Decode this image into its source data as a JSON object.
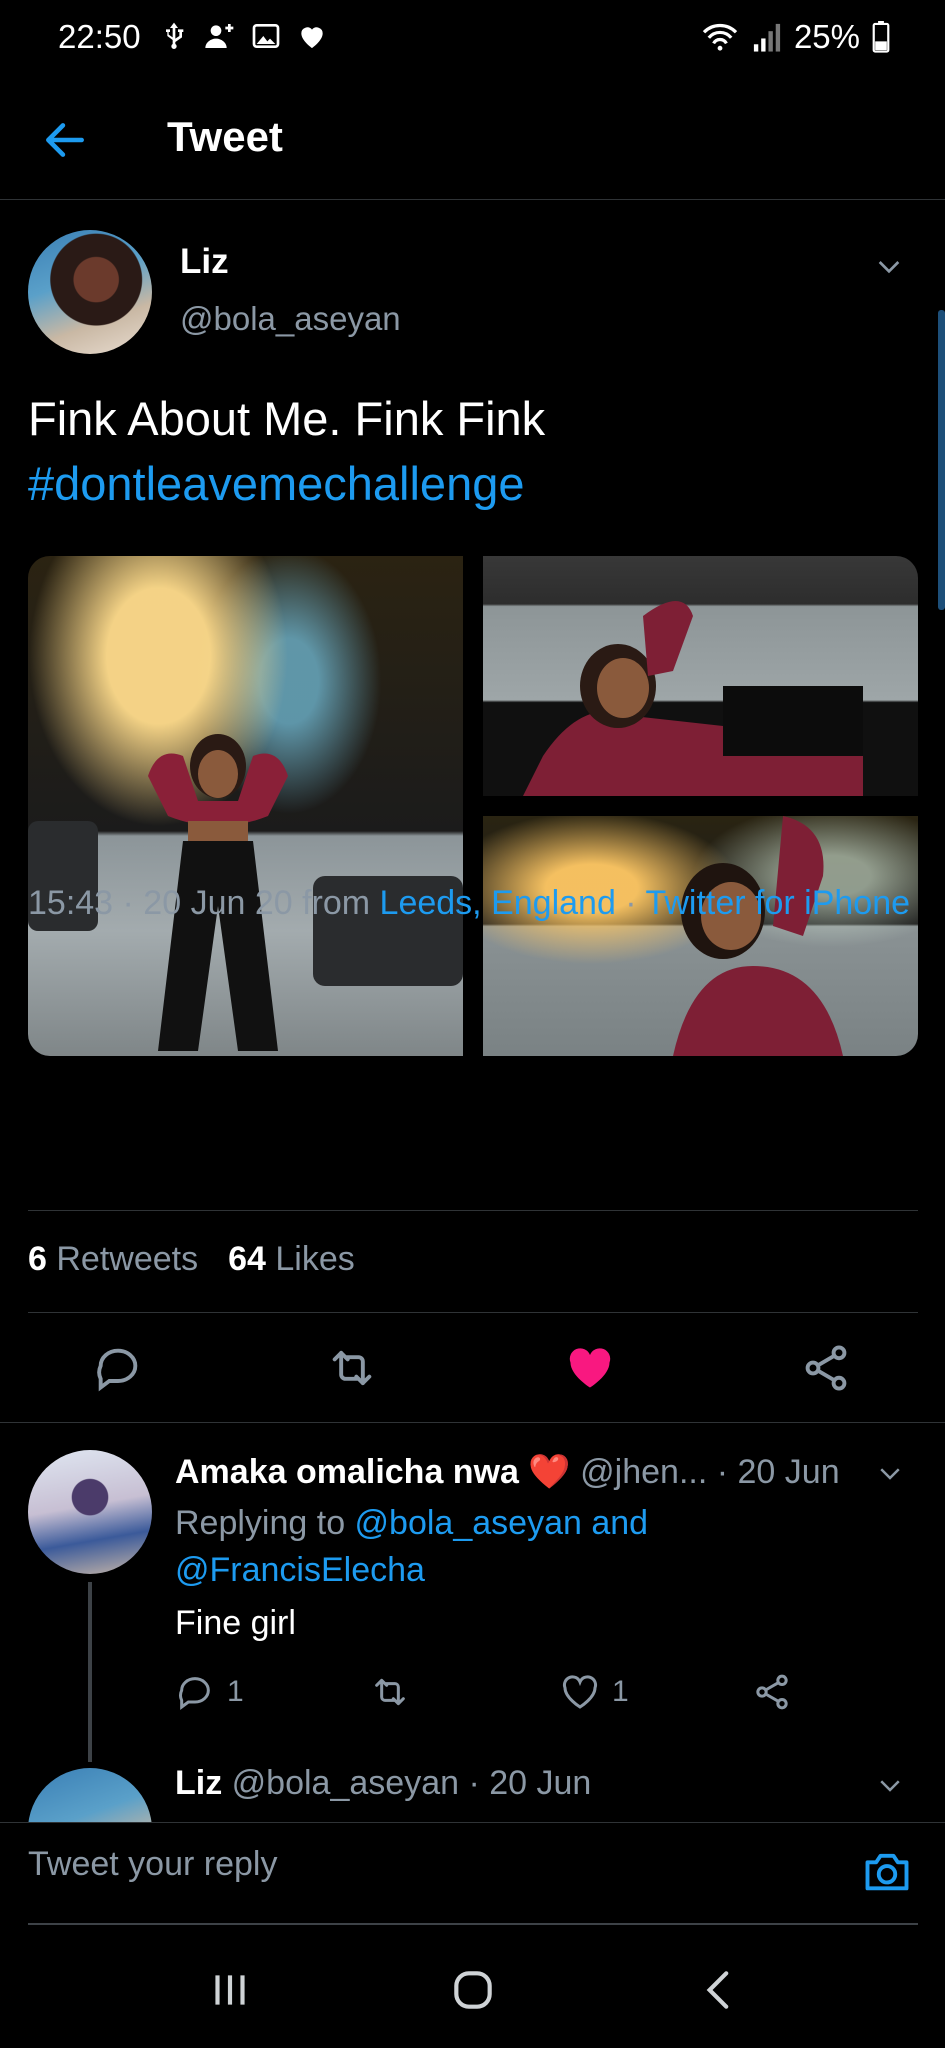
{
  "status_bar": {
    "time": "22:50",
    "battery": "25%",
    "left_icons": [
      "usb-icon",
      "person-add-icon",
      "image-icon",
      "heart-icon"
    ],
    "right_icons": [
      "wifi-icon",
      "signal-icon",
      "battery-icon"
    ]
  },
  "header": {
    "title": "Tweet"
  },
  "tweet": {
    "author_name": "Liz",
    "author_handle": "@bola_aseyan",
    "text": "Fink About Me. Fink Fink",
    "hashtag": "#dontleavemechallenge",
    "media_count": 3,
    "timestamp": "15:43 · 20 Jun 20 from ",
    "location": "Leeds, England",
    "meta_sep": " · ",
    "source": "Twitter for iPhone",
    "retweets_count": "6",
    "retweets_label": "Retweets",
    "likes_count": "64",
    "likes_label": "Likes",
    "liked": true
  },
  "replies": [
    {
      "author_name": "Amaka omalicha nwa",
      "author_emoji": "❤️",
      "author_handle": "@jhen...",
      "date": " · 20 Jun",
      "replying_prefix": "Replying to ",
      "replying_to_1": "@bola_aseyan",
      "replying_and": " and",
      "replying_to_2": "@FrancisElecha",
      "text": "Fine girl",
      "reply_count": "1",
      "like_count": "1"
    },
    {
      "author_name": "Liz",
      "author_handle": "@bola_aseyan",
      "date": " · 20 Jun"
    }
  ],
  "compose": {
    "placeholder": "Tweet your reply"
  },
  "colors": {
    "accent": "#1d9bf0",
    "like": "#f91880",
    "muted": "#8b98a5",
    "background": "#000000"
  }
}
